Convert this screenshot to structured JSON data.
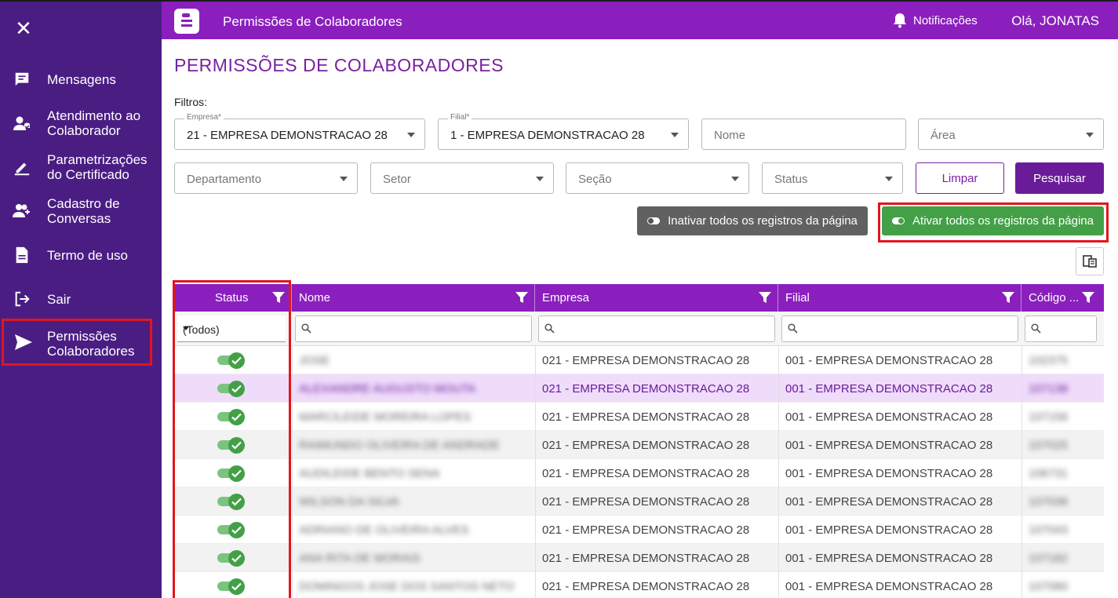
{
  "topbar": {
    "title": "Permissões de Colaboradores",
    "notifications_label": "Notificações",
    "greeting": "Olá, JONATAS"
  },
  "sidebar": {
    "items": [
      {
        "label": "Mensagens",
        "icon": "chat-icon"
      },
      {
        "label": "Atendimento ao Colaborador",
        "icon": "support-agent-icon"
      },
      {
        "label": "Parametrizações do Certificado",
        "icon": "pencil-icon"
      },
      {
        "label": "Cadastro de Conversas",
        "icon": "add-user-icon"
      },
      {
        "label": "Termo de uso",
        "icon": "document-icon"
      },
      {
        "label": "Sair",
        "icon": "logout-icon"
      },
      {
        "label": "Permissões Colaboradores",
        "icon": "send-icon",
        "active": true
      }
    ]
  },
  "page": {
    "title": "PERMISSÕES DE COLABORADORES",
    "filters_label": "Filtros:"
  },
  "filters": {
    "empresa": {
      "label": "Empresa*",
      "value": "21 - EMPRESA DEMONSTRACAO 28"
    },
    "filial": {
      "label": "Filial*",
      "value": "1 - EMPRESA DEMONSTRACAO 28"
    },
    "nome": {
      "placeholder": "Nome"
    },
    "area": {
      "placeholder": "Área"
    },
    "departamento": {
      "placeholder": "Departamento"
    },
    "setor": {
      "placeholder": "Setor"
    },
    "secao": {
      "placeholder": "Seção"
    },
    "status": {
      "placeholder": "Status"
    }
  },
  "actions": {
    "limpar": "Limpar",
    "pesquisar": "Pesquisar",
    "inativar": "Inativar todos os registros da página",
    "ativar": "Ativar todos os registros da página"
  },
  "grid": {
    "columns": [
      "Status",
      "Nome",
      "Empresa",
      "Filial",
      "Código ..."
    ],
    "status_filter_value": "(Todos)",
    "rows": [
      {
        "nome": "JOSE",
        "empresa": "021 - EMPRESA DEMONSTRACAO 28",
        "filial": "001 - EMPRESA DEMONSTRACAO 28",
        "codigo": "102375",
        "active": true
      },
      {
        "nome": "ALEXANDRE AUGUSTO MOUTA",
        "empresa": "021 - EMPRESA DEMONSTRACAO 28",
        "filial": "001 - EMPRESA DEMONSTRACAO 28",
        "codigo": "107138",
        "active": true
      },
      {
        "nome": "MARCILEIDE MOREIRA LOPES",
        "empresa": "021 - EMPRESA DEMONSTRACAO 28",
        "filial": "001 - EMPRESA DEMONSTRACAO 28",
        "codigo": "107156",
        "active": true
      },
      {
        "nome": "RAIMUNDO OLIVEIRA DE ANDRADE",
        "empresa": "021 - EMPRESA DEMONSTRACAO 28",
        "filial": "001 - EMPRESA DEMONSTRACAO 28",
        "codigo": "107025",
        "active": true
      },
      {
        "nome": "AUDILEIDE BENTO SENA",
        "empresa": "021 - EMPRESA DEMONSTRACAO 28",
        "filial": "001 - EMPRESA DEMONSTRACAO 28",
        "codigo": "106731",
        "active": true
      },
      {
        "nome": "WILSON DA SILVA",
        "empresa": "021 - EMPRESA DEMONSTRACAO 28",
        "filial": "001 - EMPRESA DEMONSTRACAO 28",
        "codigo": "107036",
        "active": true
      },
      {
        "nome": "ADRIANO DE OLIVEIRA ALVES",
        "empresa": "021 - EMPRESA DEMONSTRACAO 28",
        "filial": "001 - EMPRESA DEMONSTRACAO 28",
        "codigo": "107043",
        "active": true
      },
      {
        "nome": "ANA RITA DE MORAIS",
        "empresa": "021 - EMPRESA DEMONSTRACAO 28",
        "filial": "001 - EMPRESA DEMONSTRACAO 28",
        "codigo": "107182",
        "active": true
      },
      {
        "nome": "DOMINGOS JOSE DOS SANTOS NETO",
        "empresa": "021 - EMPRESA DEMONSTRACAO 28",
        "filial": "001 - EMPRESA DEMONSTRACAO 28",
        "codigo": "107080",
        "active": true
      }
    ]
  },
  "colors": {
    "sidebar": "#4a1d83",
    "topbar": "#8a1fbe",
    "accent": "#7b1fa2",
    "success": "#43a047",
    "highlight": "#e0161e"
  }
}
